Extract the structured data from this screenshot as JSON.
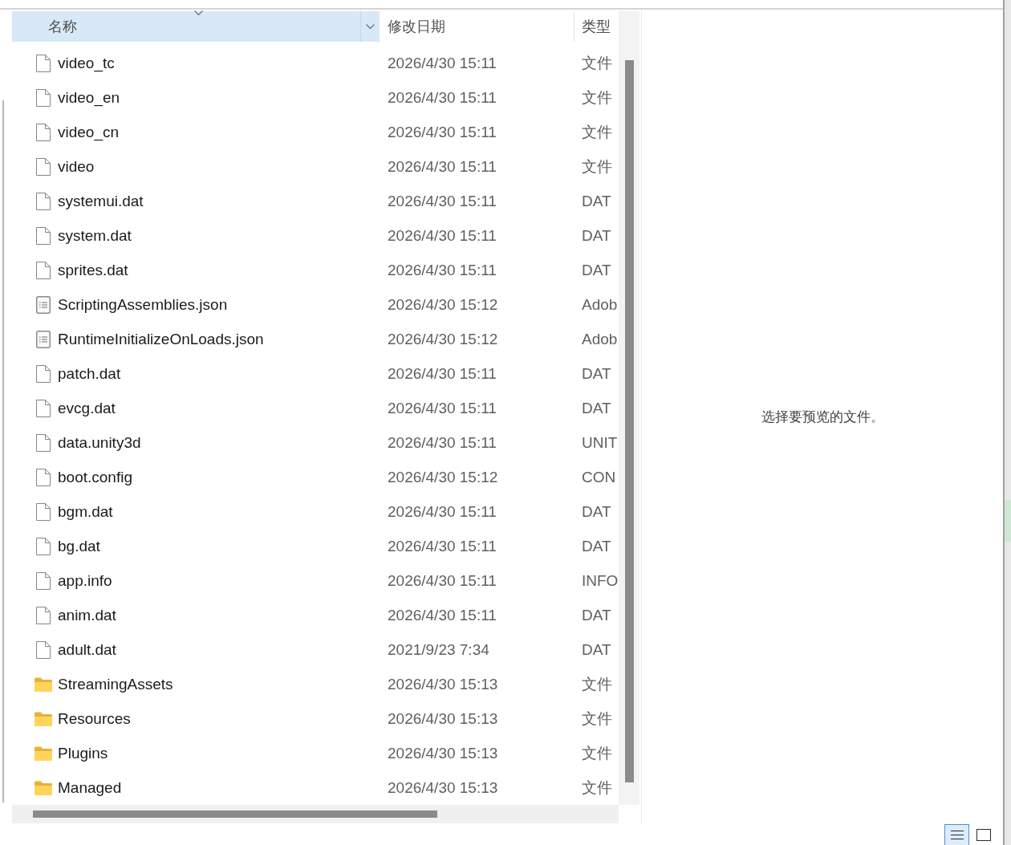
{
  "header": {
    "columns": [
      {
        "label": "名称",
        "sorted": true
      },
      {
        "label": "修改日期",
        "sorted": false
      },
      {
        "label": "类型",
        "sorted": false
      }
    ]
  },
  "files": [
    {
      "kind": "file",
      "name": "video_tc",
      "date": "2026/4/30 15:11",
      "type": "文件"
    },
    {
      "kind": "file",
      "name": "video_en",
      "date": "2026/4/30 15:11",
      "type": "文件"
    },
    {
      "kind": "file",
      "name": "video_cn",
      "date": "2026/4/30 15:11",
      "type": "文件"
    },
    {
      "kind": "file",
      "name": "video",
      "date": "2026/4/30 15:11",
      "type": "文件"
    },
    {
      "kind": "file",
      "name": "systemui.dat",
      "date": "2026/4/30 15:11",
      "type": "DAT"
    },
    {
      "kind": "file",
      "name": "system.dat",
      "date": "2026/4/30 15:11",
      "type": "DAT"
    },
    {
      "kind": "file",
      "name": "sprites.dat",
      "date": "2026/4/30 15:11",
      "type": "DAT"
    },
    {
      "kind": "text",
      "name": "ScriptingAssemblies.json",
      "date": "2026/4/30 15:12",
      "type": "Adob"
    },
    {
      "kind": "text",
      "name": "RuntimeInitializeOnLoads.json",
      "date": "2026/4/30 15:12",
      "type": "Adob"
    },
    {
      "kind": "file",
      "name": "patch.dat",
      "date": "2026/4/30 15:11",
      "type": "DAT"
    },
    {
      "kind": "file",
      "name": "evcg.dat",
      "date": "2026/4/30 15:11",
      "type": "DAT"
    },
    {
      "kind": "file",
      "name": "data.unity3d",
      "date": "2026/4/30 15:11",
      "type": "UNIT"
    },
    {
      "kind": "file",
      "name": "boot.config",
      "date": "2026/4/30 15:12",
      "type": "CON"
    },
    {
      "kind": "file",
      "name": "bgm.dat",
      "date": "2026/4/30 15:11",
      "type": "DAT"
    },
    {
      "kind": "file",
      "name": "bg.dat",
      "date": "2026/4/30 15:11",
      "type": "DAT"
    },
    {
      "kind": "file",
      "name": "app.info",
      "date": "2026/4/30 15:11",
      "type": "INFO"
    },
    {
      "kind": "file",
      "name": "anim.dat",
      "date": "2026/4/30 15:11",
      "type": "DAT"
    },
    {
      "kind": "file",
      "name": "adult.dat",
      "date": "2021/9/23 7:34",
      "type": "DAT"
    },
    {
      "kind": "folder",
      "name": "StreamingAssets",
      "date": "2026/4/30 15:13",
      "type": "文件"
    },
    {
      "kind": "folder",
      "name": "Resources",
      "date": "2026/4/30 15:13",
      "type": "文件"
    },
    {
      "kind": "folder",
      "name": "Plugins",
      "date": "2026/4/30 15:13",
      "type": "文件"
    },
    {
      "kind": "folder",
      "name": "Managed",
      "date": "2026/4/30 15:13",
      "type": "文件"
    }
  ],
  "preview": {
    "message": "选择要预览的文件。"
  },
  "view_buttons": [
    {
      "kind": "details",
      "selected": true
    },
    {
      "kind": "large_icons",
      "selected": false
    }
  ]
}
